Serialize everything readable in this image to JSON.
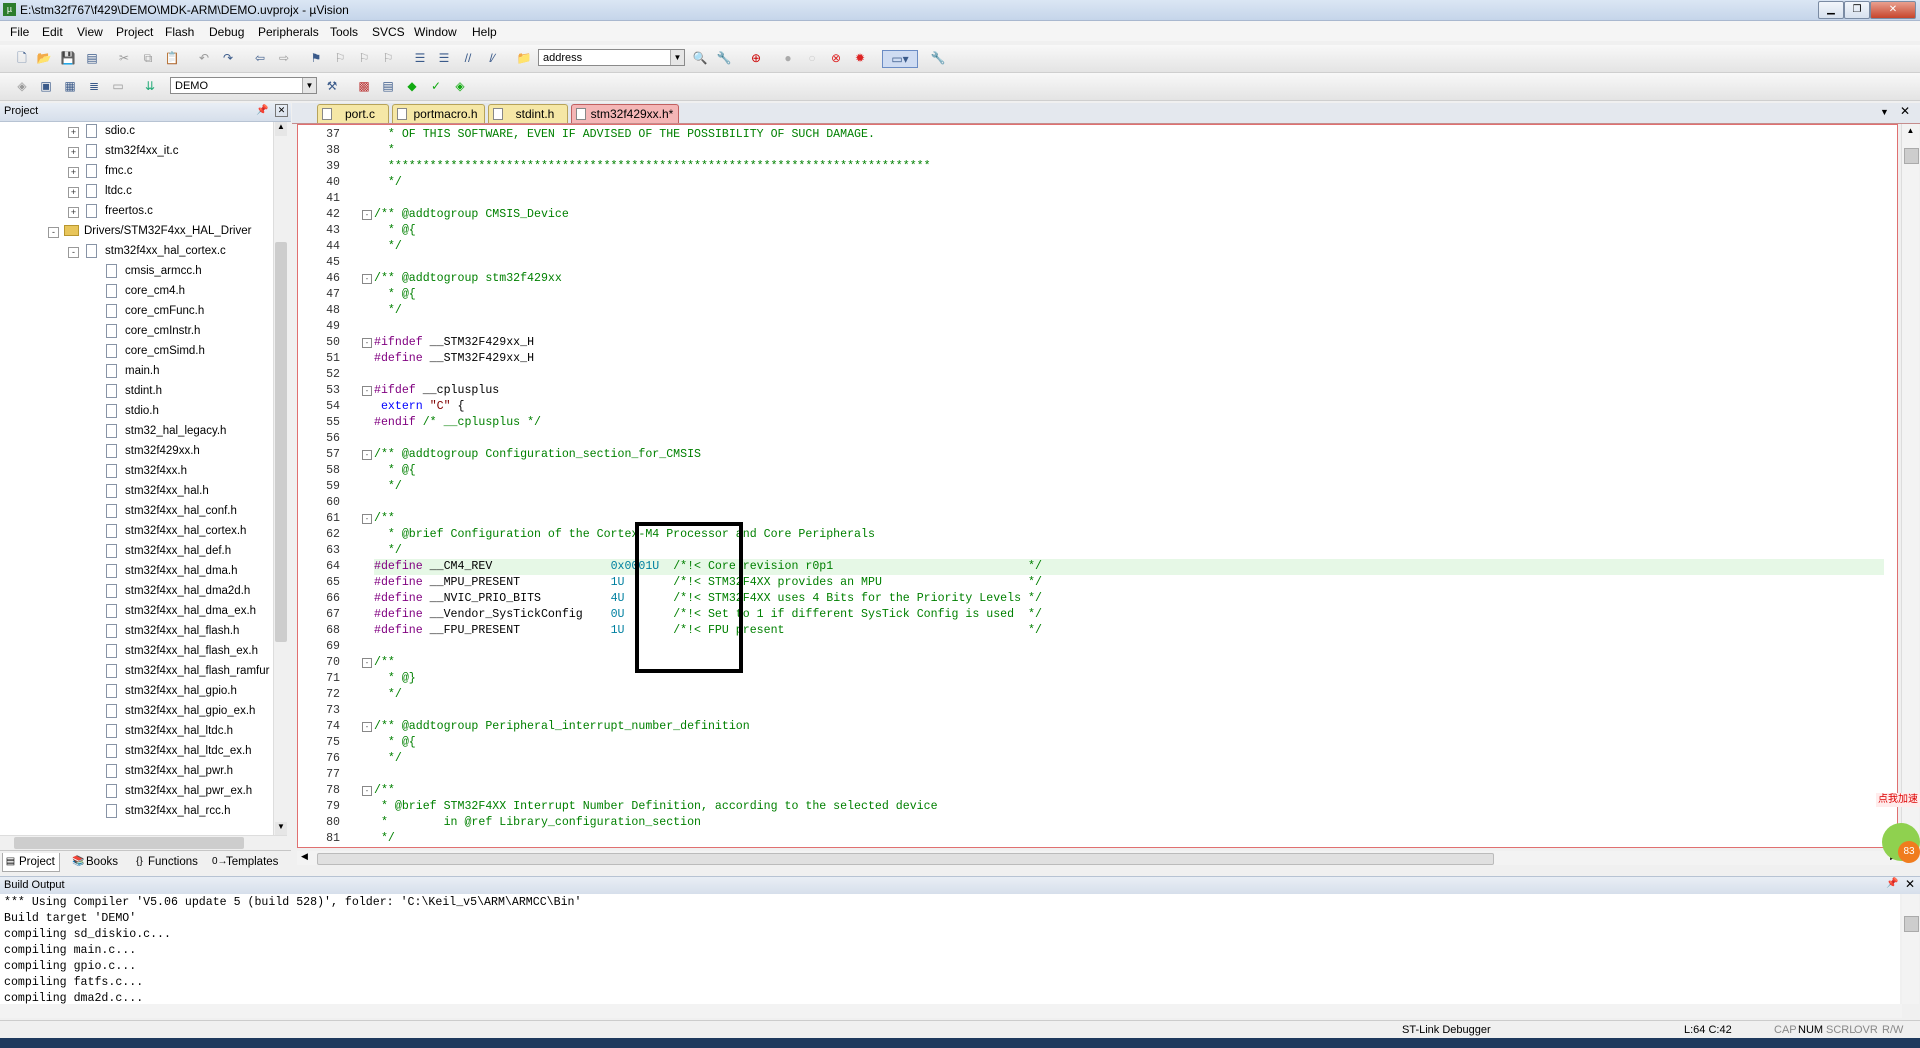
{
  "window": {
    "title": "E:\\stm32f767\\f429\\DEMO\\MDK-ARM\\DEMO.uvprojx - µVision"
  },
  "menu": [
    "File",
    "Edit",
    "View",
    "Project",
    "Flash",
    "Debug",
    "Peripherals",
    "Tools",
    "SVCS",
    "Window",
    "Help"
  ],
  "toolbar": {
    "search_value": "address",
    "target_value": "DEMO"
  },
  "project_panel": {
    "title": "Project",
    "tree": [
      {
        "label": "sdio.c",
        "level": 1,
        "kind": "file",
        "expander": "+"
      },
      {
        "label": "stm32f4xx_it.c",
        "level": 1,
        "kind": "file",
        "expander": "+"
      },
      {
        "label": "fmc.c",
        "level": 1,
        "kind": "file",
        "expander": "+"
      },
      {
        "label": "ltdc.c",
        "level": 1,
        "kind": "file",
        "expander": "+"
      },
      {
        "label": "freertos.c",
        "level": 1,
        "kind": "file",
        "expander": "+"
      },
      {
        "label": "Drivers/STM32F4xx_HAL_Driver",
        "level": 0,
        "kind": "folder",
        "expander": "-"
      },
      {
        "label": "stm32f4xx_hal_cortex.c",
        "level": 1,
        "kind": "file",
        "expander": "-"
      },
      {
        "label": "cmsis_armcc.h",
        "level": 2,
        "kind": "file"
      },
      {
        "label": "core_cm4.h",
        "level": 2,
        "kind": "file"
      },
      {
        "label": "core_cmFunc.h",
        "level": 2,
        "kind": "file"
      },
      {
        "label": "core_cmInstr.h",
        "level": 2,
        "kind": "file"
      },
      {
        "label": "core_cmSimd.h",
        "level": 2,
        "kind": "file"
      },
      {
        "label": "main.h",
        "level": 2,
        "kind": "file"
      },
      {
        "label": "stdint.h",
        "level": 2,
        "kind": "file"
      },
      {
        "label": "stdio.h",
        "level": 2,
        "kind": "file"
      },
      {
        "label": "stm32_hal_legacy.h",
        "level": 2,
        "kind": "file"
      },
      {
        "label": "stm32f429xx.h",
        "level": 2,
        "kind": "file"
      },
      {
        "label": "stm32f4xx.h",
        "level": 2,
        "kind": "file"
      },
      {
        "label": "stm32f4xx_hal.h",
        "level": 2,
        "kind": "file"
      },
      {
        "label": "stm32f4xx_hal_conf.h",
        "level": 2,
        "kind": "file"
      },
      {
        "label": "stm32f4xx_hal_cortex.h",
        "level": 2,
        "kind": "file"
      },
      {
        "label": "stm32f4xx_hal_def.h",
        "level": 2,
        "kind": "file"
      },
      {
        "label": "stm32f4xx_hal_dma.h",
        "level": 2,
        "kind": "file"
      },
      {
        "label": "stm32f4xx_hal_dma2d.h",
        "level": 2,
        "kind": "file"
      },
      {
        "label": "stm32f4xx_hal_dma_ex.h",
        "level": 2,
        "kind": "file"
      },
      {
        "label": "stm32f4xx_hal_flash.h",
        "level": 2,
        "kind": "file"
      },
      {
        "label": "stm32f4xx_hal_flash_ex.h",
        "level": 2,
        "kind": "file"
      },
      {
        "label": "stm32f4xx_hal_flash_ramfur",
        "level": 2,
        "kind": "file"
      },
      {
        "label": "stm32f4xx_hal_gpio.h",
        "level": 2,
        "kind": "file"
      },
      {
        "label": "stm32f4xx_hal_gpio_ex.h",
        "level": 2,
        "kind": "file"
      },
      {
        "label": "stm32f4xx_hal_ltdc.h",
        "level": 2,
        "kind": "file"
      },
      {
        "label": "stm32f4xx_hal_ltdc_ex.h",
        "level": 2,
        "kind": "file"
      },
      {
        "label": "stm32f4xx_hal_pwr.h",
        "level": 2,
        "kind": "file"
      },
      {
        "label": "stm32f4xx_hal_pwr_ex.h",
        "level": 2,
        "kind": "file"
      },
      {
        "label": "stm32f4xx_hal_rcc.h",
        "level": 2,
        "kind": "file"
      }
    ],
    "tabs": [
      "Project",
      "Books",
      "Functions",
      "Templates"
    ]
  },
  "editor": {
    "tabs": [
      {
        "label": "port.c",
        "active": false
      },
      {
        "label": "portmacro.h",
        "active": false
      },
      {
        "label": "stdint.h",
        "active": false
      },
      {
        "label": "stm32f429xx.h*",
        "active": true
      }
    ],
    "highlight_line": 64,
    "lines": [
      {
        "n": "37",
        "fold": "",
        "html": "<span class='cm'>  * OF THIS SOFTWARE, EVEN IF ADVISED OF THE POSSIBILITY OF SUCH DAMAGE.</span>"
      },
      {
        "n": "38",
        "fold": "",
        "html": "<span class='cm'>  *</span>"
      },
      {
        "n": "39",
        "fold": "",
        "html": "<span class='cm'>  ******************************************************************************</span>"
      },
      {
        "n": "40",
        "fold": "",
        "html": "<span class='cm'>  */</span>"
      },
      {
        "n": "41",
        "fold": "",
        "html": ""
      },
      {
        "n": "42",
        "fold": "-",
        "html": "<span class='cm'>/** @addtogroup CMSIS_Device</span>"
      },
      {
        "n": "43",
        "fold": "",
        "html": "<span class='cm'>  * @{</span>"
      },
      {
        "n": "44",
        "fold": "",
        "html": "<span class='cm'>  */</span>"
      },
      {
        "n": "45",
        "fold": "",
        "html": ""
      },
      {
        "n": "46",
        "fold": "-",
        "html": "<span class='cm'>/** @addtogroup stm32f429xx</span>"
      },
      {
        "n": "47",
        "fold": "",
        "html": "<span class='cm'>  * @{</span>"
      },
      {
        "n": "48",
        "fold": "",
        "html": "<span class='cm'>  */</span>"
      },
      {
        "n": "49",
        "fold": "",
        "html": ""
      },
      {
        "n": "50",
        "fold": "-",
        "html": "<span class='pp'>#ifndef</span> __STM32F429xx_H"
      },
      {
        "n": "51",
        "fold": "",
        "html": "<span class='pp'>#define</span> __STM32F429xx_H"
      },
      {
        "n": "52",
        "fold": "",
        "html": ""
      },
      {
        "n": "53",
        "fold": "-",
        "html": "<span class='pp'>#ifdef</span> __cplusplus"
      },
      {
        "n": "54",
        "fold": "",
        "html": " <span class='kw'>extern</span> <span class='st'>\"C\"</span> {"
      },
      {
        "n": "55",
        "fold": "",
        "html": "<span class='pp'>#endif</span> <span class='cm'>/* __cplusplus */</span>"
      },
      {
        "n": "56",
        "fold": "",
        "html": ""
      },
      {
        "n": "57",
        "fold": "-",
        "html": "<span class='cm'>/** @addtogroup Configuration_section_for_CMSIS</span>"
      },
      {
        "n": "58",
        "fold": "",
        "html": "<span class='cm'>  * @{</span>"
      },
      {
        "n": "59",
        "fold": "",
        "html": "<span class='cm'>  */</span>"
      },
      {
        "n": "60",
        "fold": "",
        "html": ""
      },
      {
        "n": "61",
        "fold": "-",
        "html": "<span class='cm'>/**</span>"
      },
      {
        "n": "62",
        "fold": "",
        "html": "<span class='cm'>  * @brief Configuration of the Cortex-M4 Processor and Core Peripherals</span>"
      },
      {
        "n": "63",
        "fold": "",
        "html": "<span class='cm'>  */</span>"
      },
      {
        "n": "64",
        "fold": "",
        "html": "<span class='pp'>#define</span> __CM4_REV                 <span class='nm'>0x0001U</span>  <span class='cm'>/*!&lt; Core revision r0p1                            */</span>"
      },
      {
        "n": "65",
        "fold": "",
        "html": "<span class='pp'>#define</span> __MPU_PRESENT             <span class='nm'>1U</span>       <span class='cm'>/*!&lt; STM32F4XX provides an MPU                     */</span>"
      },
      {
        "n": "66",
        "fold": "",
        "html": "<span class='pp'>#define</span> __NVIC_PRIO_BITS          <span class='nm'>4U</span>       <span class='cm'>/*!&lt; STM32F4XX uses 4 Bits for the Priority Levels */</span>"
      },
      {
        "n": "67",
        "fold": "",
        "html": "<span class='pp'>#define</span> __Vendor_SysTickConfig    <span class='nm'>0U</span>       <span class='cm'>/*!&lt; Set to 1 if different SysTick Config is used  */</span>"
      },
      {
        "n": "68",
        "fold": "",
        "html": "<span class='pp'>#define</span> __FPU_PRESENT             <span class='nm'>1U</span>       <span class='cm'>/*!&lt; FPU present                                   */</span>"
      },
      {
        "n": "69",
        "fold": "",
        "html": ""
      },
      {
        "n": "70",
        "fold": "-",
        "html": "<span class='cm'>/**</span>"
      },
      {
        "n": "71",
        "fold": "",
        "html": "<span class='cm'>  * @}</span>"
      },
      {
        "n": "72",
        "fold": "",
        "html": "<span class='cm'>  */</span>"
      },
      {
        "n": "73",
        "fold": "",
        "html": ""
      },
      {
        "n": "74",
        "fold": "-",
        "html": "<span class='cm'>/** @addtogroup Peripheral_interrupt_number_definition</span>"
      },
      {
        "n": "75",
        "fold": "",
        "html": "<span class='cm'>  * @{</span>"
      },
      {
        "n": "76",
        "fold": "",
        "html": "<span class='cm'>  */</span>"
      },
      {
        "n": "77",
        "fold": "",
        "html": ""
      },
      {
        "n": "78",
        "fold": "-",
        "html": "<span class='cm'>/**</span>"
      },
      {
        "n": "79",
        "fold": "",
        "html": "<span class='cm'> * @brief STM32F4XX Interrupt Number Definition, according to the selected device</span>"
      },
      {
        "n": "80",
        "fold": "",
        "html": "<span class='cm'> *        in @ref Library_configuration_section</span>"
      },
      {
        "n": "81",
        "fold": "",
        "html": "<span class='cm'> */</span>"
      }
    ]
  },
  "build_output": {
    "title": "Build Output",
    "lines": [
      "*** Using Compiler 'V5.06 update 5 (build 528)', folder: 'C:\\Keil_v5\\ARM\\ARMCC\\Bin'",
      "Build target 'DEMO'",
      "compiling sd_diskio.c...",
      "compiling main.c...",
      "compiling gpio.c...",
      "compiling fatfs.c...",
      "compiling dma2d.c..."
    ]
  },
  "status": {
    "debugger": "ST-Link Debugger",
    "position": "L:64 C:42",
    "caps": "CAP",
    "num": "NUM",
    "scrl": "SCRL",
    "ovr": "OVR",
    "rw": "R/W"
  },
  "widget": {
    "label": "点我加速",
    "value": "83"
  },
  "colors": {
    "comment": "#008000",
    "preprocessor": "#800080",
    "keyword": "#0000ff",
    "number": "#0080a0",
    "active_tab": "#f4b6b6",
    "inactive_tab": "#f5e7a6",
    "highlight_line": "#e6f8e6"
  }
}
